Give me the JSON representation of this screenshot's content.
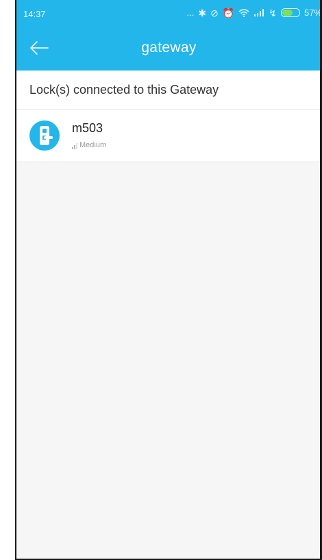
{
  "status_bar": {
    "time": "14:37",
    "more": "...",
    "battery_label": "57%",
    "battery_level": 0.57
  },
  "app_bar": {
    "title": "gateway",
    "back_icon": "back-arrow-icon"
  },
  "section": {
    "title": "Lock(s) connected to this Gateway"
  },
  "locks": [
    {
      "name": "m503",
      "signal": "Medium",
      "icon": "door-lock-icon"
    }
  ],
  "colors": {
    "primary": "#23b6ea",
    "background": "#f6f6f6"
  }
}
